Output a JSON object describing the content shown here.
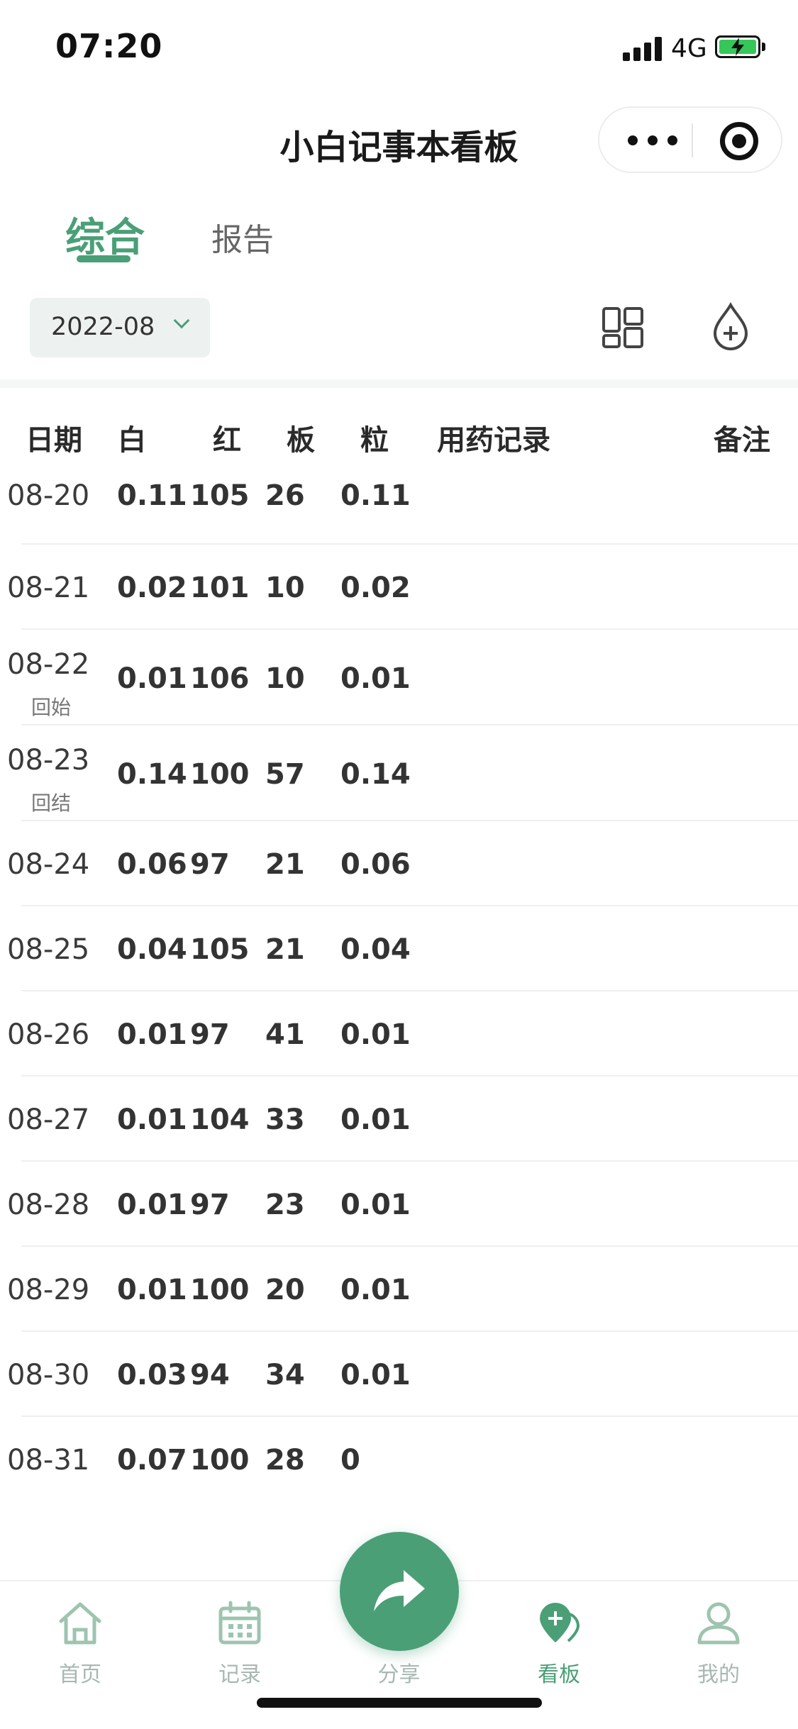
{
  "status_bar": {
    "time": "07:20",
    "network": "4G"
  },
  "header": {
    "title": "小白记事本看板"
  },
  "tabs": [
    {
      "label": "综合",
      "active": true
    },
    {
      "label": "报告",
      "active": false
    }
  ],
  "filter": {
    "month": "2022-08"
  },
  "table": {
    "headers": [
      "日期",
      "白",
      "红",
      "板",
      "粒",
      "用药记录",
      "备注"
    ],
    "rows": [
      {
        "date": "08-20",
        "note": "",
        "white": "0.11",
        "red": "105",
        "platelet": "26",
        "grain": "0.11"
      },
      {
        "date": "08-21",
        "note": "",
        "white": "0.02",
        "red": "101",
        "platelet": "10",
        "grain": "0.02"
      },
      {
        "date": "08-22",
        "note": "回始",
        "white": "0.01",
        "red": "106",
        "platelet": "10",
        "grain": "0.01"
      },
      {
        "date": "08-23",
        "note": "回结",
        "white": "0.14",
        "red": "100",
        "platelet": "57",
        "grain": "0.14"
      },
      {
        "date": "08-24",
        "note": "",
        "white": "0.06",
        "red": "97",
        "platelet": "21",
        "grain": "0.06"
      },
      {
        "date": "08-25",
        "note": "",
        "white": "0.04",
        "red": "105",
        "platelet": "21",
        "grain": "0.04"
      },
      {
        "date": "08-26",
        "note": "",
        "white": "0.01",
        "red": "97",
        "platelet": "41",
        "grain": "0.01"
      },
      {
        "date": "08-27",
        "note": "",
        "white": "0.01",
        "red": "104",
        "platelet": "33",
        "grain": "0.01"
      },
      {
        "date": "08-28",
        "note": "",
        "white": "0.01",
        "red": "97",
        "platelet": "23",
        "grain": "0.01"
      },
      {
        "date": "08-29",
        "note": "",
        "white": "0.01",
        "red": "100",
        "platelet": "20",
        "grain": "0.01"
      },
      {
        "date": "08-30",
        "note": "",
        "white": "0.03",
        "red": "94",
        "platelet": "34",
        "grain": "0.01"
      },
      {
        "date": "08-31",
        "note": "",
        "white": "0.07",
        "red": "100",
        "platelet": "28",
        "grain": "0"
      }
    ]
  },
  "nav": {
    "items": [
      {
        "label": "首页",
        "icon": "home-icon",
        "active": false
      },
      {
        "label": "记录",
        "icon": "calendar-icon",
        "active": false
      },
      {
        "label": "分享",
        "icon": "share-arrow-icon",
        "active": false
      },
      {
        "label": "看板",
        "icon": "board-pin-icon",
        "active": true
      },
      {
        "label": "我的",
        "icon": "user-icon",
        "active": false
      }
    ]
  },
  "colors": {
    "accent": "#4a9f77",
    "inactive": "#a8b8b0",
    "chip_bg": "#edf1ef"
  }
}
